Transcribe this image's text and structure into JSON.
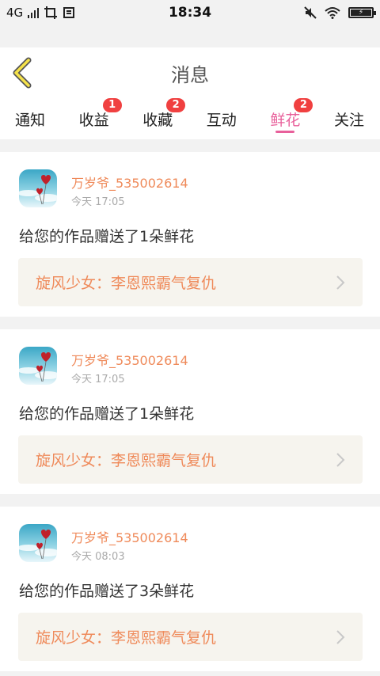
{
  "status_bar": {
    "network": "4G",
    "time": "18:34",
    "battery_icon": "battery-charging-icon"
  },
  "header": {
    "title": "消息"
  },
  "tabs": [
    {
      "label": "通知",
      "badge": ""
    },
    {
      "label": "收益",
      "badge": "1"
    },
    {
      "label": "收藏",
      "badge": "2"
    },
    {
      "label": "互动",
      "badge": ""
    },
    {
      "label": "鲜花",
      "badge": "2",
      "active": true
    },
    {
      "label": "关注",
      "badge": ""
    }
  ],
  "messages": [
    {
      "user": "万岁爷_535002614",
      "time": "今天 17:05",
      "text": "给您的作品赠送了1朵鲜花",
      "work_title": "旋风少女：李恩熙霸气复仇"
    },
    {
      "user": "万岁爷_535002614",
      "time": "今天 17:05",
      "text": "给您的作品赠送了1朵鲜花",
      "work_title": "旋风少女：李恩熙霸气复仇"
    },
    {
      "user": "万岁爷_535002614",
      "time": "今天 08:03",
      "text": "给您的作品赠送了3朵鲜花",
      "work_title": "旋风少女：李恩熙霸气复仇"
    }
  ],
  "colors": {
    "accent_pink": "#e8609b",
    "username_orange": "#ef8a5a",
    "badge_red": "#f04040",
    "back_arrow_yellow": "#f5e24a"
  }
}
